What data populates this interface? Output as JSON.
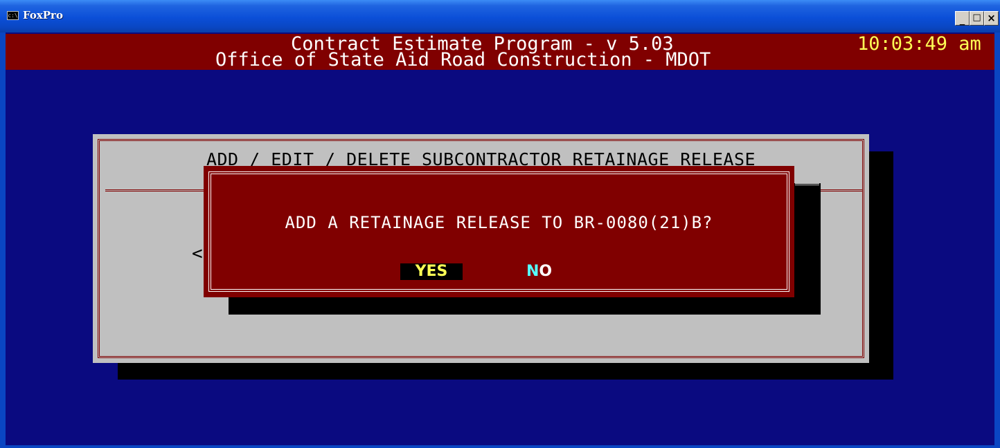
{
  "window": {
    "title": "FoxPro",
    "icon": "console-icon",
    "controls": {
      "minimize": "_",
      "maximize": "□",
      "close": "×"
    }
  },
  "header": {
    "line1": "Contract Estimate Program - v 5.03",
    "line2": "Office of State Aid Road Construction - MDOT",
    "clock": "10:03:49 am"
  },
  "panel": {
    "title": "ADD / EDIT / DELETE SUBCONTRACTOR RETAINAGE RELEASE",
    "glyph": "<"
  },
  "dialog": {
    "question": "ADD A RETAINAGE RELEASE TO BR-0080(21)B?",
    "yes_label": "YES",
    "no_hotkey": "N",
    "no_rest": "O"
  },
  "colors": {
    "background": "#0a0a80",
    "header_band": "#800000",
    "clock": "#ffff55",
    "panel": "#c0c0c0",
    "dialog": "#800000",
    "yes_text": "#ffff55",
    "no_hotkey": "#55ffff"
  }
}
